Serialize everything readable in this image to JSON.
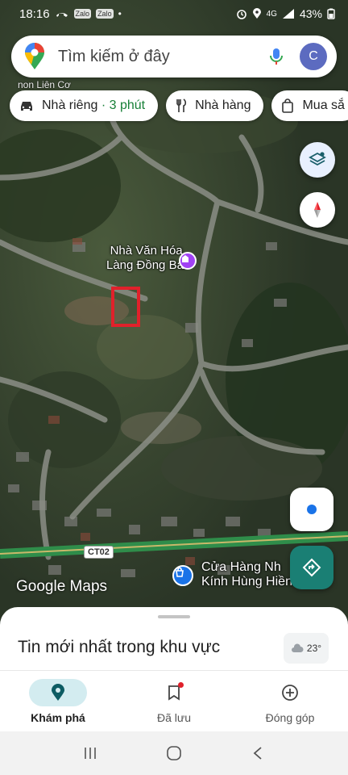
{
  "status_bar": {
    "time": "18:16",
    "left_badges": [
      "Zalo",
      "Zalo"
    ],
    "signal_text": "4G",
    "battery": "43%"
  },
  "search": {
    "placeholder": "Tìm kiếm ở đây",
    "avatar_letter": "C"
  },
  "behind_label": "non Liên Cơ",
  "chips": [
    {
      "label": "Nhà riêng",
      "eta": " · 3 phút",
      "icon": "car-icon"
    },
    {
      "label": "Nhà hàng",
      "icon": "restaurant-icon"
    },
    {
      "label": "Mua sắ",
      "icon": "shopping-bag-icon"
    }
  ],
  "map": {
    "poi_name": "Nhà Văn Hóa\nLàng Đồng Bái",
    "road_shield": "CT02",
    "store_name": "Cửa Hàng Nh\nKính Hùng Hiền",
    "watermark": "Google Maps"
  },
  "sheet": {
    "title": "Tin mới nhất trong khu vực",
    "weather": "23°"
  },
  "nav": {
    "explore": "Khám phá",
    "saved": "Đã lưu",
    "contribute": "Đóng góp"
  },
  "colors": {
    "accent_teal": "#1a7f74",
    "eta_green": "#188038",
    "highlight_red": "#e0212b",
    "active_tab_bg": "#d3ecf0"
  }
}
